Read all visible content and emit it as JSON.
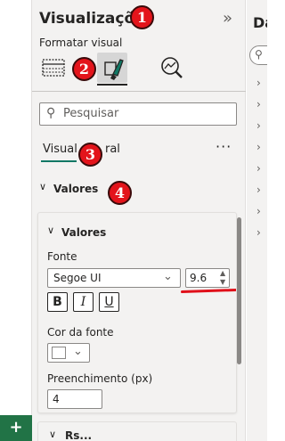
{
  "left_strip": {
    "add_label": "+"
  },
  "viz_pane": {
    "title": "Visualizações",
    "collapse_icon": "»",
    "format_section_label": "Formatar visual",
    "search": {
      "placeholder": "Pesquisar",
      "icon": "search-icon"
    },
    "tabs": [
      {
        "label": "Visual",
        "active": true
      },
      {
        "label": "ral",
        "active": false
      }
    ],
    "more_label": "···",
    "section": {
      "label": "Valores",
      "expanded": true
    },
    "card": {
      "header": "Valores",
      "font_label": "Fonte",
      "font_family": "Segoe UI",
      "font_size": "9.6",
      "bold_label": "B",
      "italic_label": "I",
      "underline_label": "U",
      "font_color_label": "Cor da fonte",
      "font_color": "#ffffff",
      "padding_label": "Preenchimento (px)",
      "padding_value": "4"
    },
    "next_section_label": "Rs..."
  },
  "data_pane": {
    "title": "Da",
    "collapsed_items": 8
  },
  "callouts": [
    "1",
    "2",
    "3",
    "4"
  ],
  "colors": {
    "accent_tab": "#117865",
    "callout": "#e3141b",
    "annotation_line": "#e0101a",
    "add_page": "#217346"
  }
}
